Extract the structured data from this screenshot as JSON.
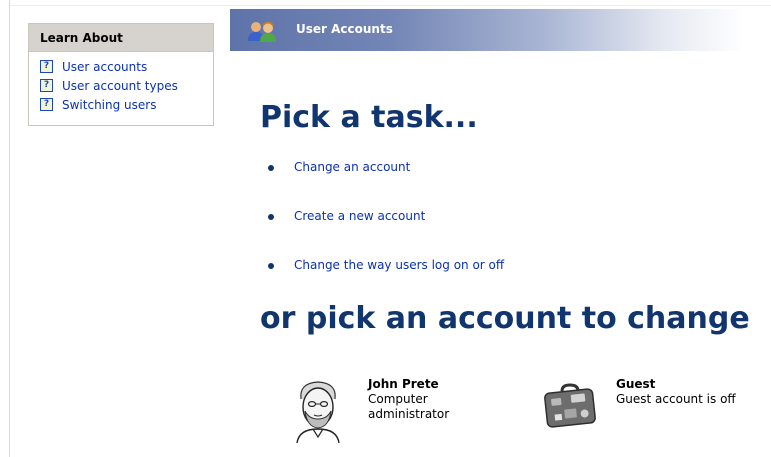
{
  "learn_about": {
    "header": "Learn About",
    "items": [
      {
        "label": "User accounts",
        "icon": "help-icon"
      },
      {
        "label": "User account types",
        "icon": "help-icon"
      },
      {
        "label": "Switching users",
        "icon": "help-icon"
      }
    ],
    "help_glyph": "?"
  },
  "title_bar": {
    "title": "User Accounts",
    "icon": "user-accounts-icon"
  },
  "tasks": {
    "heading": "Pick a task...",
    "items": [
      {
        "label": "Change an account"
      },
      {
        "label": "Create a new account"
      },
      {
        "label": "Change the way users log on or off"
      }
    ]
  },
  "accounts": {
    "heading": "or pick an account to change",
    "items": [
      {
        "name": "John Prete",
        "role": "Computer administrator",
        "icon": "portrait-avatar-icon"
      },
      {
        "name": "Guest",
        "role": "Guest account is off",
        "icon": "suitcase-avatar-icon"
      }
    ]
  },
  "colors": {
    "heading": "#11356e",
    "link": "#0b30b6",
    "title_bar_start": "#5e73a8",
    "panel_header": "#d6d3ce"
  }
}
